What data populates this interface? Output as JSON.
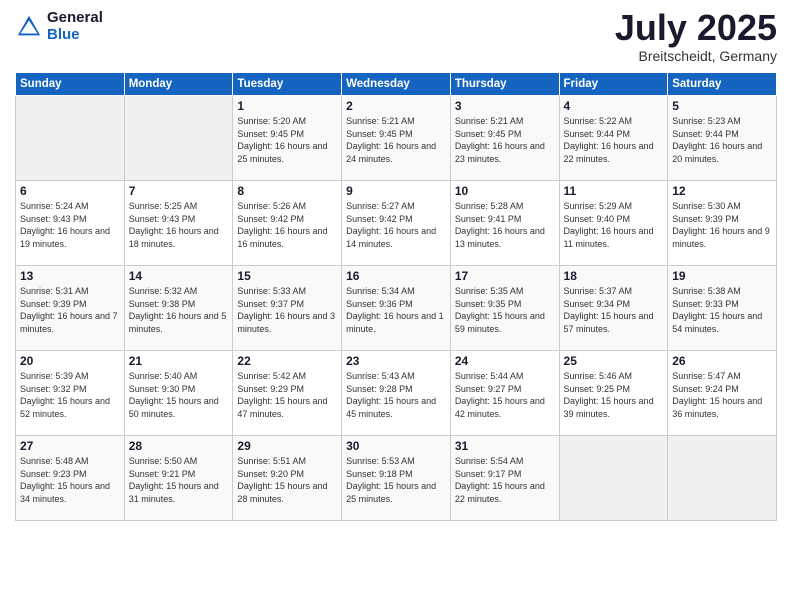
{
  "logo": {
    "general": "General",
    "blue": "Blue"
  },
  "title": "July 2025",
  "location": "Breitscheidt, Germany",
  "days_of_week": [
    "Sunday",
    "Monday",
    "Tuesday",
    "Wednesday",
    "Thursday",
    "Friday",
    "Saturday"
  ],
  "weeks": [
    [
      {
        "day": "",
        "sunrise": "",
        "sunset": "",
        "daylight": ""
      },
      {
        "day": "",
        "sunrise": "",
        "sunset": "",
        "daylight": ""
      },
      {
        "day": "1",
        "sunrise": "Sunrise: 5:20 AM",
        "sunset": "Sunset: 9:45 PM",
        "daylight": "Daylight: 16 hours and 25 minutes."
      },
      {
        "day": "2",
        "sunrise": "Sunrise: 5:21 AM",
        "sunset": "Sunset: 9:45 PM",
        "daylight": "Daylight: 16 hours and 24 minutes."
      },
      {
        "day": "3",
        "sunrise": "Sunrise: 5:21 AM",
        "sunset": "Sunset: 9:45 PM",
        "daylight": "Daylight: 16 hours and 23 minutes."
      },
      {
        "day": "4",
        "sunrise": "Sunrise: 5:22 AM",
        "sunset": "Sunset: 9:44 PM",
        "daylight": "Daylight: 16 hours and 22 minutes."
      },
      {
        "day": "5",
        "sunrise": "Sunrise: 5:23 AM",
        "sunset": "Sunset: 9:44 PM",
        "daylight": "Daylight: 16 hours and 20 minutes."
      }
    ],
    [
      {
        "day": "6",
        "sunrise": "Sunrise: 5:24 AM",
        "sunset": "Sunset: 9:43 PM",
        "daylight": "Daylight: 16 hours and 19 minutes."
      },
      {
        "day": "7",
        "sunrise": "Sunrise: 5:25 AM",
        "sunset": "Sunset: 9:43 PM",
        "daylight": "Daylight: 16 hours and 18 minutes."
      },
      {
        "day": "8",
        "sunrise": "Sunrise: 5:26 AM",
        "sunset": "Sunset: 9:42 PM",
        "daylight": "Daylight: 16 hours and 16 minutes."
      },
      {
        "day": "9",
        "sunrise": "Sunrise: 5:27 AM",
        "sunset": "Sunset: 9:42 PM",
        "daylight": "Daylight: 16 hours and 14 minutes."
      },
      {
        "day": "10",
        "sunrise": "Sunrise: 5:28 AM",
        "sunset": "Sunset: 9:41 PM",
        "daylight": "Daylight: 16 hours and 13 minutes."
      },
      {
        "day": "11",
        "sunrise": "Sunrise: 5:29 AM",
        "sunset": "Sunset: 9:40 PM",
        "daylight": "Daylight: 16 hours and 11 minutes."
      },
      {
        "day": "12",
        "sunrise": "Sunrise: 5:30 AM",
        "sunset": "Sunset: 9:39 PM",
        "daylight": "Daylight: 16 hours and 9 minutes."
      }
    ],
    [
      {
        "day": "13",
        "sunrise": "Sunrise: 5:31 AM",
        "sunset": "Sunset: 9:39 PM",
        "daylight": "Daylight: 16 hours and 7 minutes."
      },
      {
        "day": "14",
        "sunrise": "Sunrise: 5:32 AM",
        "sunset": "Sunset: 9:38 PM",
        "daylight": "Daylight: 16 hours and 5 minutes."
      },
      {
        "day": "15",
        "sunrise": "Sunrise: 5:33 AM",
        "sunset": "Sunset: 9:37 PM",
        "daylight": "Daylight: 16 hours and 3 minutes."
      },
      {
        "day": "16",
        "sunrise": "Sunrise: 5:34 AM",
        "sunset": "Sunset: 9:36 PM",
        "daylight": "Daylight: 16 hours and 1 minute."
      },
      {
        "day": "17",
        "sunrise": "Sunrise: 5:35 AM",
        "sunset": "Sunset: 9:35 PM",
        "daylight": "Daylight: 15 hours and 59 minutes."
      },
      {
        "day": "18",
        "sunrise": "Sunrise: 5:37 AM",
        "sunset": "Sunset: 9:34 PM",
        "daylight": "Daylight: 15 hours and 57 minutes."
      },
      {
        "day": "19",
        "sunrise": "Sunrise: 5:38 AM",
        "sunset": "Sunset: 9:33 PM",
        "daylight": "Daylight: 15 hours and 54 minutes."
      }
    ],
    [
      {
        "day": "20",
        "sunrise": "Sunrise: 5:39 AM",
        "sunset": "Sunset: 9:32 PM",
        "daylight": "Daylight: 15 hours and 52 minutes."
      },
      {
        "day": "21",
        "sunrise": "Sunrise: 5:40 AM",
        "sunset": "Sunset: 9:30 PM",
        "daylight": "Daylight: 15 hours and 50 minutes."
      },
      {
        "day": "22",
        "sunrise": "Sunrise: 5:42 AM",
        "sunset": "Sunset: 9:29 PM",
        "daylight": "Daylight: 15 hours and 47 minutes."
      },
      {
        "day": "23",
        "sunrise": "Sunrise: 5:43 AM",
        "sunset": "Sunset: 9:28 PM",
        "daylight": "Daylight: 15 hours and 45 minutes."
      },
      {
        "day": "24",
        "sunrise": "Sunrise: 5:44 AM",
        "sunset": "Sunset: 9:27 PM",
        "daylight": "Daylight: 15 hours and 42 minutes."
      },
      {
        "day": "25",
        "sunrise": "Sunrise: 5:46 AM",
        "sunset": "Sunset: 9:25 PM",
        "daylight": "Daylight: 15 hours and 39 minutes."
      },
      {
        "day": "26",
        "sunrise": "Sunrise: 5:47 AM",
        "sunset": "Sunset: 9:24 PM",
        "daylight": "Daylight: 15 hours and 36 minutes."
      }
    ],
    [
      {
        "day": "27",
        "sunrise": "Sunrise: 5:48 AM",
        "sunset": "Sunset: 9:23 PM",
        "daylight": "Daylight: 15 hours and 34 minutes."
      },
      {
        "day": "28",
        "sunrise": "Sunrise: 5:50 AM",
        "sunset": "Sunset: 9:21 PM",
        "daylight": "Daylight: 15 hours and 31 minutes."
      },
      {
        "day": "29",
        "sunrise": "Sunrise: 5:51 AM",
        "sunset": "Sunset: 9:20 PM",
        "daylight": "Daylight: 15 hours and 28 minutes."
      },
      {
        "day": "30",
        "sunrise": "Sunrise: 5:53 AM",
        "sunset": "Sunset: 9:18 PM",
        "daylight": "Daylight: 15 hours and 25 minutes."
      },
      {
        "day": "31",
        "sunrise": "Sunrise: 5:54 AM",
        "sunset": "Sunset: 9:17 PM",
        "daylight": "Daylight: 15 hours and 22 minutes."
      },
      {
        "day": "",
        "sunrise": "",
        "sunset": "",
        "daylight": ""
      },
      {
        "day": "",
        "sunrise": "",
        "sunset": "",
        "daylight": ""
      }
    ]
  ]
}
